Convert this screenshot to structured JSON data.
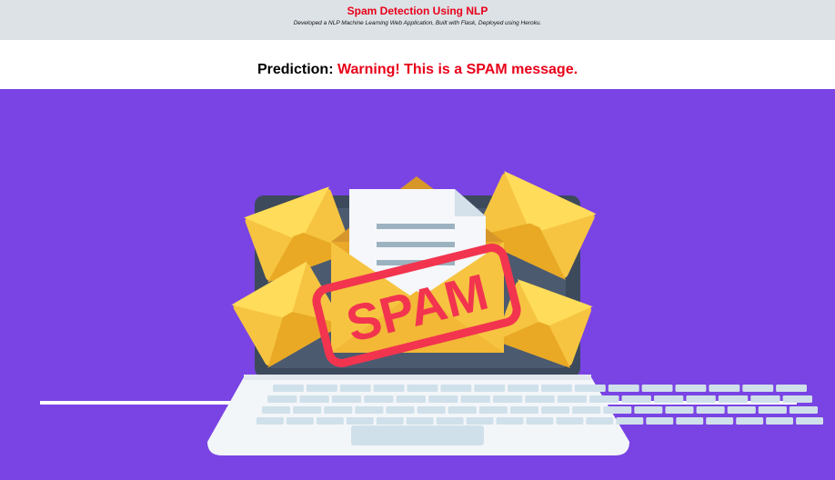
{
  "header": {
    "title": "Spam Detection Using NLP",
    "subtitle": "Developed a NLP Machine Learning Web Application, Built with Flask, Deployed using Heroku."
  },
  "prediction": {
    "label": "Prediction:",
    "value": "Warning! This is a SPAM message."
  },
  "illustration": {
    "stamp_text": "SPAM",
    "colors": {
      "background": "#7a43e4",
      "envelope": "#f6c441",
      "envelope_shade": "#e9a925",
      "stamp": "#f2344f",
      "laptop_screen": "#3d4a5c",
      "laptop_body": "#f3f6f9",
      "keys": "#cfe0ea"
    },
    "icon": "laptop-spam-illustration"
  },
  "colors": {
    "header_bg": "#dde2e6",
    "title": "#e8001a",
    "warning": "#e8001a"
  }
}
